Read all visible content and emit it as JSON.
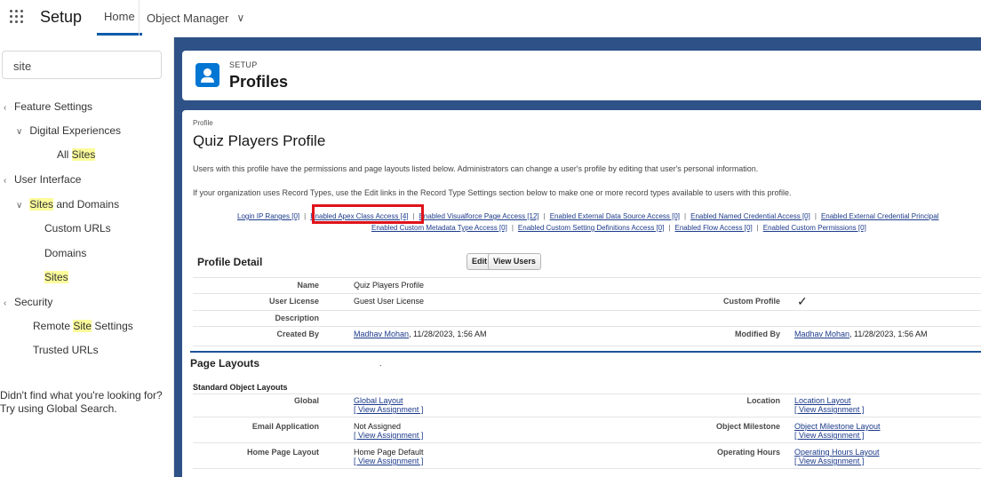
{
  "topbar": {
    "app_name": "Setup",
    "tabs": [
      {
        "label": "Home"
      },
      {
        "label": "Object Manager"
      }
    ]
  },
  "sidebar": {
    "search_value": "site",
    "items": [
      {
        "pre": "",
        "hl": "",
        "post": "Feature Settings"
      },
      {
        "pre": "Digital Experiences",
        "hl": "",
        "post": ""
      },
      {
        "pre": "All ",
        "hl": "Sites",
        "post": ""
      },
      {
        "pre": "User Interface",
        "hl": "",
        "post": ""
      },
      {
        "pre": "",
        "hl": "Sites",
        "post": " and Domains"
      },
      {
        "pre": "Custom URLs",
        "hl": "",
        "post": ""
      },
      {
        "pre": "Domains",
        "hl": "",
        "post": ""
      },
      {
        "pre": "",
        "hl": "Sites",
        "post": ""
      },
      {
        "pre": "Security",
        "hl": "",
        "post": ""
      },
      {
        "pre": "Remote ",
        "hl": "Site",
        "post": " Settings"
      },
      {
        "pre": "Trusted URLs",
        "hl": "",
        "post": ""
      }
    ],
    "footer_line1": "Didn't find what you're looking for?",
    "footer_line2": "Try using Global Search."
  },
  "header": {
    "breadcrumb": "SETUP",
    "title": "Profiles"
  },
  "profile": {
    "label": "Profile",
    "name": "Quiz Players Profile",
    "info1": "Users with this profile have the permissions and page layouts listed below. Administrators can change a user's profile by editing that user's personal information.",
    "info2": "If your organization uses Record Types, use the Edit links in the Record Type Settings section below to make one or more record types available to users with this profile."
  },
  "links": {
    "row1": [
      "Login IP Ranges [0]",
      "Enabled Apex Class Access [4]",
      "Enabled Visualforce Page Access [12]",
      "Enabled External Data Source Access [0]",
      "Enabled Named Credential Access [0]",
      "Enabled External Credential Principal"
    ],
    "row2": [
      "Enabled Custom Metadata Type Access [0]",
      "Enabled Custom Setting Definitions Access [0]",
      "Enabled Flow Access [0]",
      "Enabled Custom Permissions [0]"
    ],
    "separator": "|"
  },
  "profile_detail": {
    "title": "Profile Detail",
    "edit_label": "Edit",
    "view_users_label": "View Users",
    "name_label": "Name",
    "name_value": "Quiz Players Profile",
    "user_license_label": "User License",
    "user_license_value": "Guest User License",
    "custom_profile_label": "Custom Profile",
    "custom_profile_value": "✓",
    "description_label": "Description",
    "created_by_label": "Created By",
    "created_by_user": "Madhav Mohan",
    "created_by_date": ", 11/28/2023, 1:56 AM",
    "modified_by_label": "Modified By",
    "modified_by_user": "Madhav Mohan",
    "modified_by_date": ", 11/28/2023, 1:56 AM"
  },
  "page_layouts": {
    "title": "Page Layouts",
    "dot": ".",
    "standard_title": "Standard Object Layouts",
    "view_assignment": "[ View Assignment ]",
    "global_label": "Global",
    "global_value": "Global Layout",
    "location_label": "Location",
    "location_value": "Location Layout",
    "email_label": "Email Application",
    "email_value": "Not Assigned",
    "milestone_label": "Object Milestone",
    "milestone_value": "Object Milestone Layout",
    "home_label": "Home Page Layout",
    "home_value": "Home Page Default",
    "hours_label": "Operating Hours",
    "hours_value": "Operating Hours Layout"
  }
}
